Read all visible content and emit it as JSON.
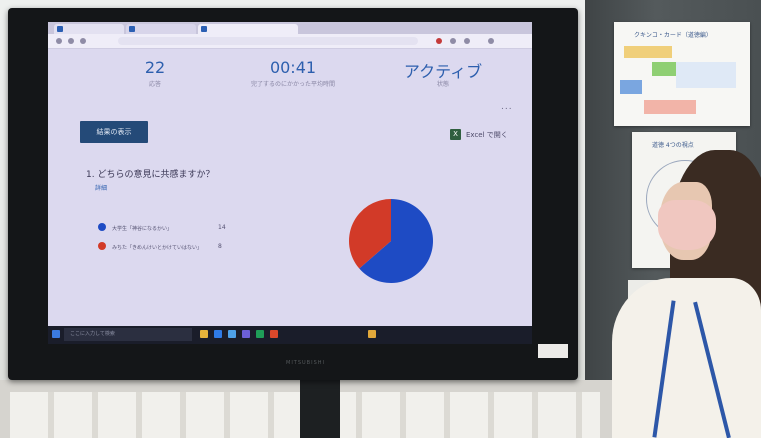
{
  "screen": {
    "stats": [
      {
        "value": "22",
        "label": "応答"
      },
      {
        "value": "00:41",
        "label": "完了するのにかかった平均時間"
      },
      {
        "value": "アクティブ",
        "label": "状態"
      }
    ],
    "view_results_label": "結果の表示",
    "excel_label": "Excel で開く",
    "excel_icon_glyph": "X",
    "question": "1. どちらの意見に共感ますか？",
    "details_label": "詳細",
    "more_label": "...",
    "poll": [
      {
        "label": "大学生「神谷になるかい」",
        "count": "14",
        "color": "#1e4bc4"
      },
      {
        "label": "みちた「きめんけいとかけていはない」",
        "count": "8",
        "color": "#d23a28"
      }
    ],
    "taskbar_search": "ここに入力して検索"
  },
  "tv_brand": "MITSUBISHI",
  "wall": {
    "poster1_title": "クキンコ・カード（道徳編）",
    "poster2_title": "道徳 4つの視点"
  },
  "colors": {
    "blue": "#1e4bc4",
    "red": "#d23a28",
    "accent": "#2d5fae"
  }
}
